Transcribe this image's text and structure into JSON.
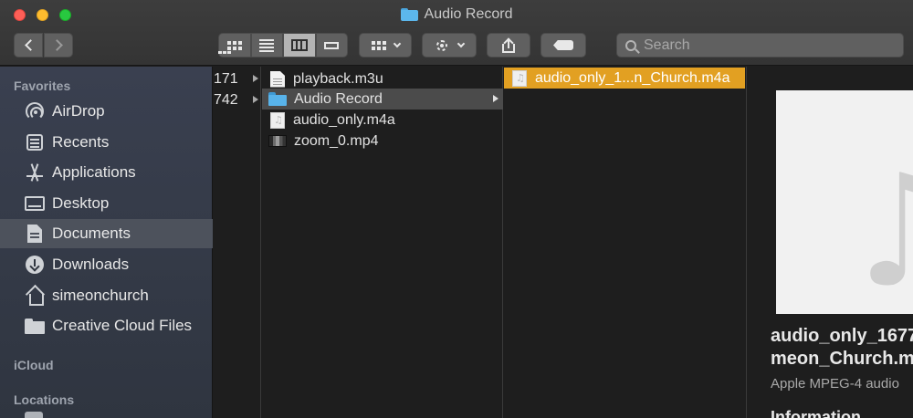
{
  "window": {
    "title": "Audio Record"
  },
  "search": {
    "placeholder": "Search"
  },
  "sidebar": {
    "favorites_header": "Favorites",
    "icloud_header": "iCloud",
    "locations_header": "Locations",
    "items": [
      {
        "label": "AirDrop",
        "icon": "airdrop-icon"
      },
      {
        "label": "Recents",
        "icon": "recents-icon"
      },
      {
        "label": "Applications",
        "icon": "applications-icon"
      },
      {
        "label": "Desktop",
        "icon": "desktop-icon"
      },
      {
        "label": "Documents",
        "icon": "documents-icon",
        "selected": true
      },
      {
        "label": "Downloads",
        "icon": "downloads-icon"
      },
      {
        "label": "simeonchurch",
        "icon": "home-icon"
      },
      {
        "label": "Creative Cloud Files",
        "icon": "folder-icon"
      }
    ]
  },
  "columns": {
    "partial": [
      "171",
      "742"
    ],
    "folder": [
      {
        "name": "playback.m3u",
        "type": "document"
      },
      {
        "name": "Audio Record",
        "type": "folder",
        "selected": true
      },
      {
        "name": "audio_only.m4a",
        "type": "audio"
      },
      {
        "name": "zoom_0.mp4",
        "type": "video"
      }
    ],
    "subfolder": [
      {
        "name": "audio_only_1...n_Church.m4a",
        "type": "audio",
        "selected": true
      }
    ]
  },
  "preview": {
    "name_line1": "audio_only_1677",
    "name_line2": "meon_Church.m",
    "kind": "Apple MPEG-4 audio",
    "info_header": "Information"
  },
  "colors": {
    "selection_active": "#e2a022",
    "selection_inactive": "#4b4b4b",
    "folder_blue": "#58b3ea"
  }
}
